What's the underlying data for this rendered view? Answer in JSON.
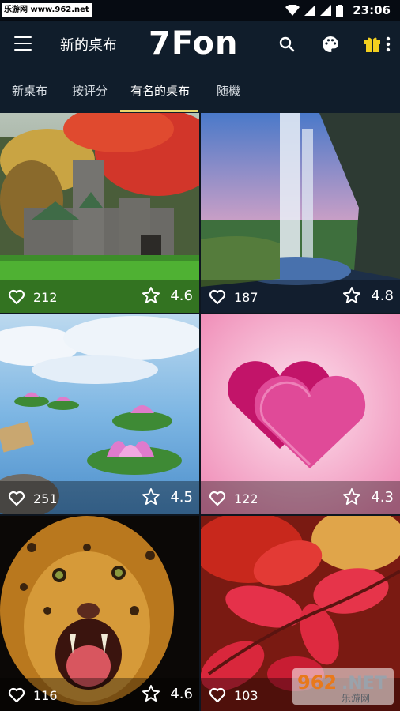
{
  "status_bar": {
    "watermark": "乐游网 www.962.net",
    "time": "23:06"
  },
  "app_bar": {
    "title": "新的桌布",
    "logo": "7Fon",
    "icons": [
      "menu-icon",
      "search-icon",
      "palette-icon",
      "gift-icon",
      "more-icon"
    ]
  },
  "tabs": [
    {
      "label": "新桌布",
      "active": false
    },
    {
      "label": "按评分",
      "active": false
    },
    {
      "label": "有名的桌布",
      "active": true
    },
    {
      "label": "随機",
      "active": false
    }
  ],
  "tiles": [
    {
      "likes": "212",
      "rating": "4.6",
      "subject": "castle"
    },
    {
      "likes": "187",
      "rating": "4.8",
      "subject": "waterfall"
    },
    {
      "likes": "251",
      "rating": "4.5",
      "subject": "lotus"
    },
    {
      "likes": "122",
      "rating": "4.3",
      "subject": "hearts"
    },
    {
      "likes": "116",
      "rating": "4.6",
      "subject": "leopard"
    },
    {
      "likes": "103",
      "rating": "",
      "subject": "red-leaves"
    }
  ],
  "watermark_bottom": {
    "logo": "962.NET",
    "sub": "乐游网"
  },
  "colors": {
    "appbar": "#101d2b",
    "indicator": "#e9d66c",
    "statusbar": "#060b12"
  }
}
